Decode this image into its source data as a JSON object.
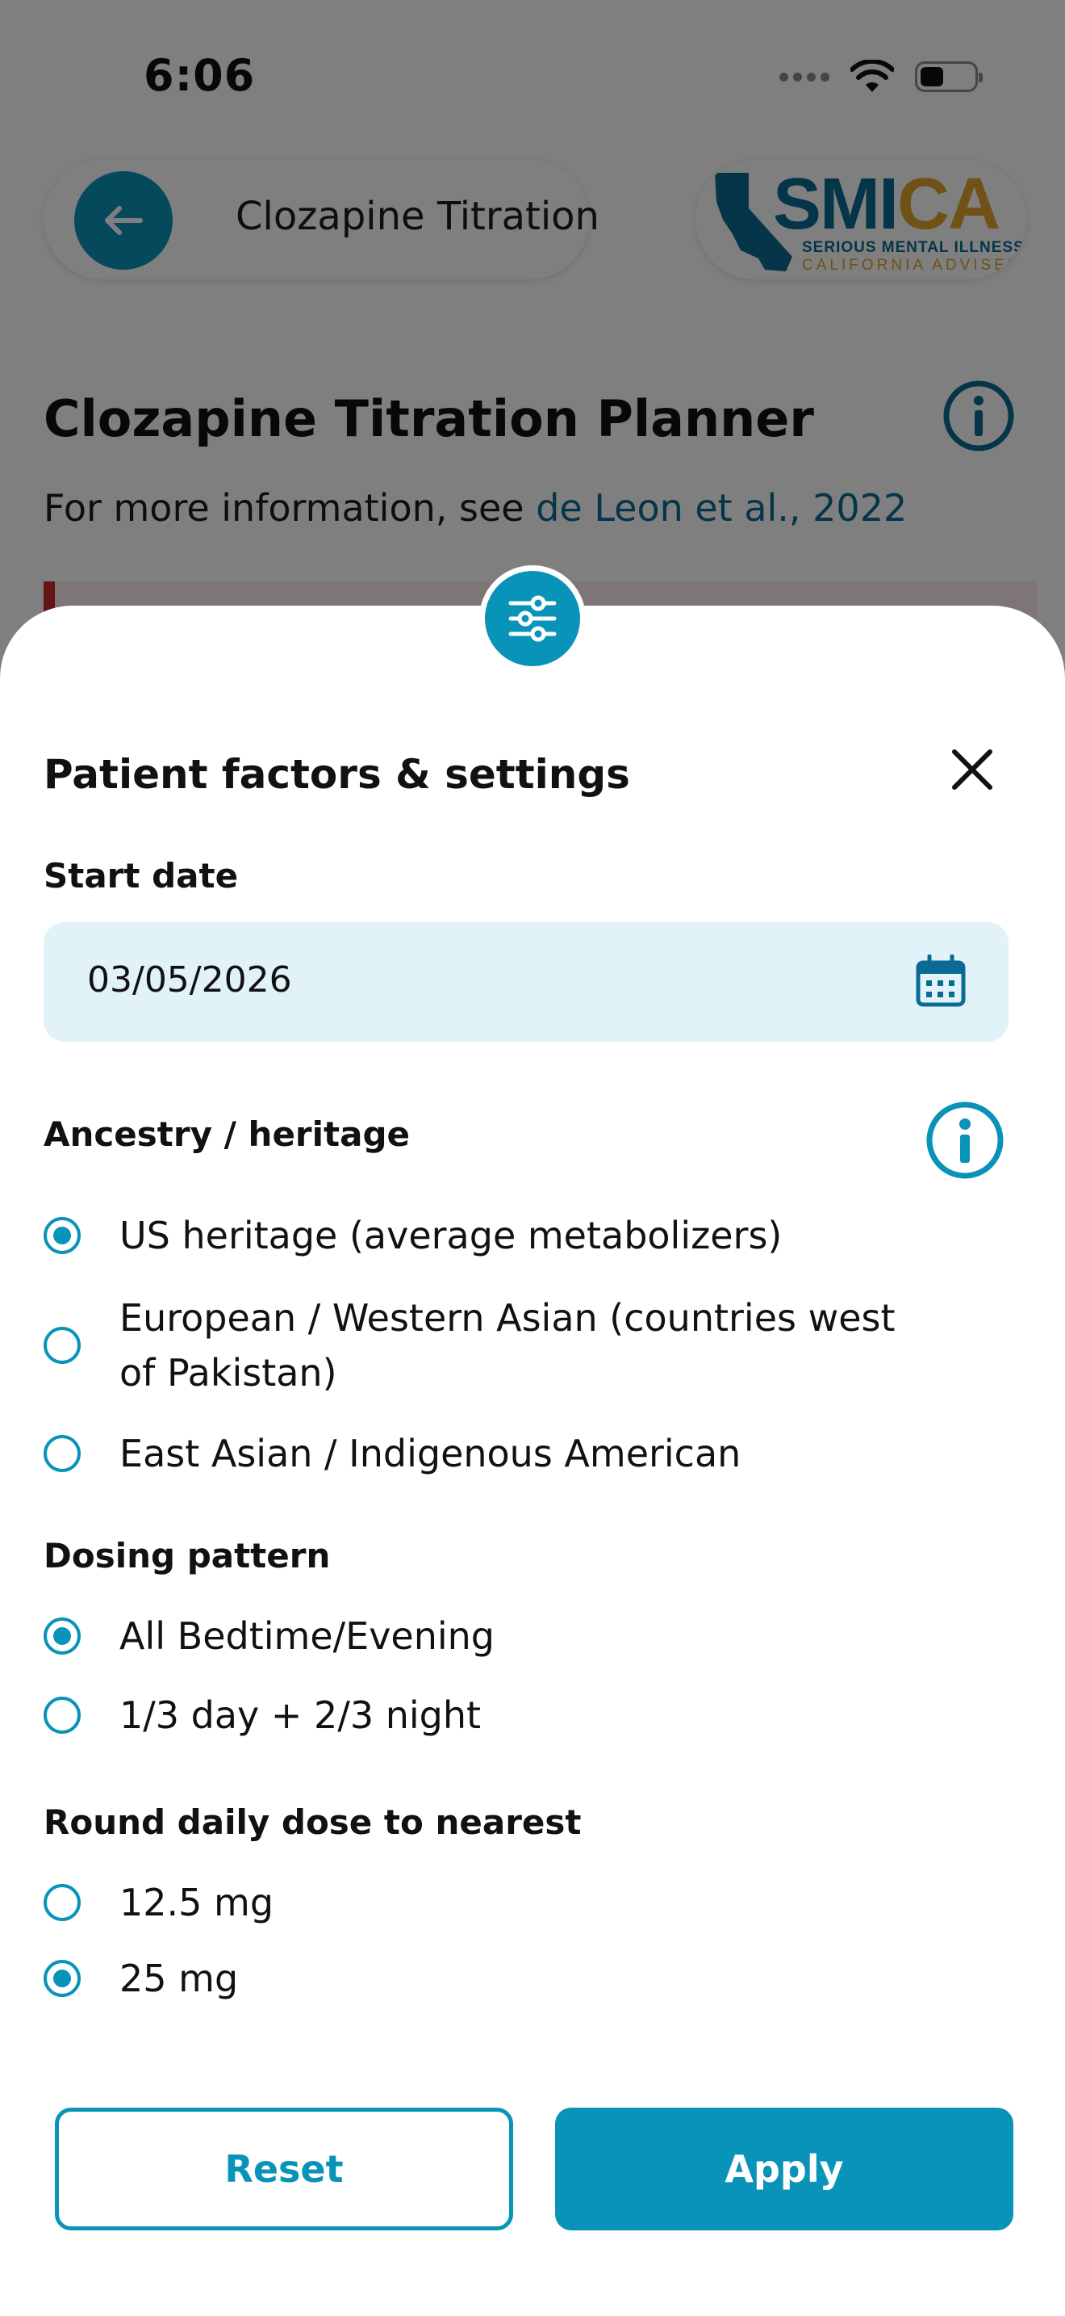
{
  "status_bar": {
    "time": "6:06"
  },
  "header": {
    "title": "Clozapine Titration",
    "logo": {
      "brand_left": "SMI",
      "brand_right": "CA",
      "line1": "SERIOUS MENTAL ILLNESS",
      "line2": "CALIFORNIA ADVISEI"
    }
  },
  "page": {
    "title": "Clozapine Titration Planner",
    "subtitle_prefix": "For more information, see ",
    "subtitle_link": "de Leon et al., 2022"
  },
  "sheet": {
    "title": "Patient factors & settings",
    "start_date": {
      "label": "Start date",
      "value": "03/05/2026"
    },
    "ancestry": {
      "label": "Ancestry / heritage",
      "options": [
        {
          "label": "US heritage (average metabolizers)",
          "selected": true
        },
        {
          "label": "European / Western Asian (countries west of Pakistan)",
          "selected": false
        },
        {
          "label": "East Asian / Indigenous American",
          "selected": false
        }
      ]
    },
    "dosing": {
      "label": "Dosing pattern",
      "options": [
        {
          "label": "All Bedtime/Evening",
          "selected": true
        },
        {
          "label": "1/3 day + 2/3 night",
          "selected": false
        }
      ]
    },
    "rounding": {
      "label": "Round daily dose to nearest",
      "options": [
        {
          "label": "12.5 mg",
          "selected": false
        },
        {
          "label": "25 mg",
          "selected": true
        }
      ]
    },
    "buttons": {
      "reset": "Reset",
      "apply": "Apply"
    }
  },
  "colors": {
    "accent": "#0a93b8",
    "link": "#0a6b93",
    "field_bg": "#e1f2f8",
    "logo_gold": "#e0a22c"
  }
}
